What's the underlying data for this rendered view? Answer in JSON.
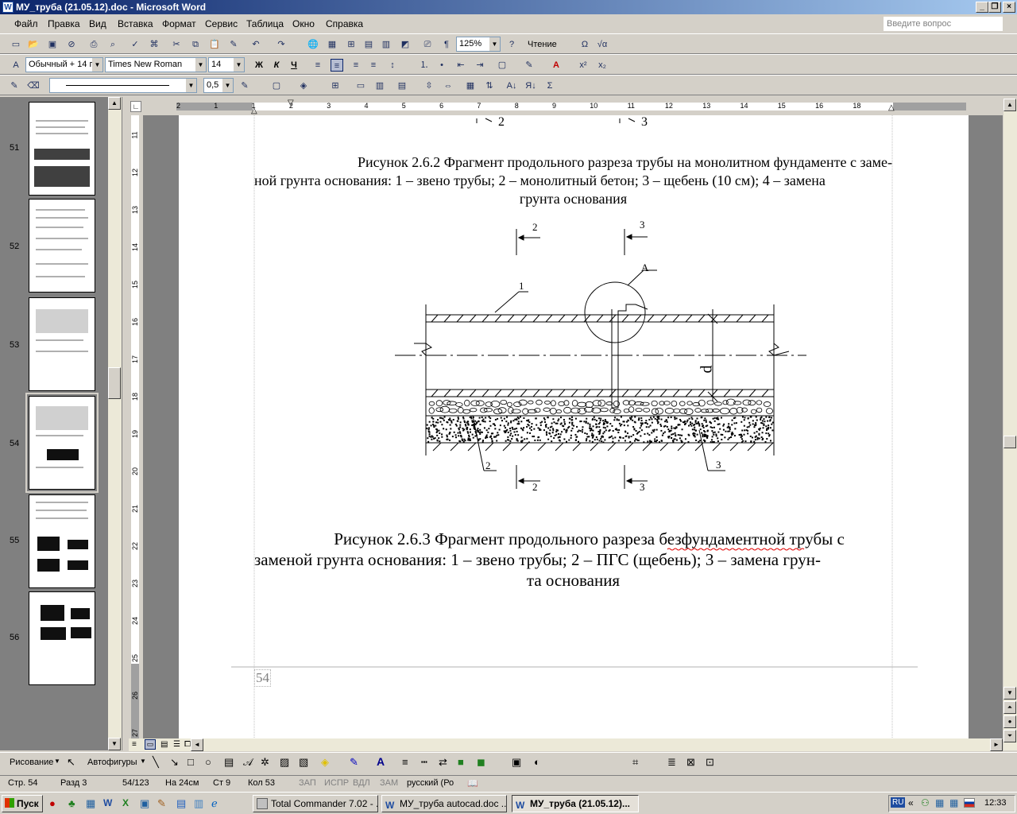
{
  "window": {
    "title": "МУ_труба (21.05.12).doc - Microsoft Word",
    "minimize": "_",
    "restore": "❐",
    "close": "×"
  },
  "menu": {
    "items": [
      "Файл",
      "Правка",
      "Вид",
      "Вставка",
      "Формат",
      "Сервис",
      "Таблица",
      "Окно",
      "Справка"
    ],
    "ask_placeholder": "Введите вопрос"
  },
  "toolbar1": {
    "zoom": "125%",
    "reading": "Чтение"
  },
  "toolbar2": {
    "style": "Обычный + 14 п",
    "font": "Times New Roman",
    "size": "14",
    "bold": "Ж",
    "italic": "К",
    "underline": "Ч"
  },
  "toolbar3": {
    "line_width": "0,5"
  },
  "ruler": {
    "h_ticks": [
      "2",
      "1",
      "1",
      "2",
      "3",
      "4",
      "5",
      "6",
      "7",
      "8",
      "9",
      "10",
      "11",
      "12",
      "13",
      "14",
      "15",
      "16",
      "18"
    ],
    "v_ticks": [
      "11",
      "12",
      "13",
      "14",
      "15",
      "16",
      "17",
      "18",
      "19",
      "20",
      "21",
      "22",
      "23",
      "24",
      "25",
      "26",
      "27"
    ]
  },
  "thumbnails": [
    {
      "num": "51"
    },
    {
      "num": "52"
    },
    {
      "num": "53"
    },
    {
      "num": "54"
    },
    {
      "num": "55"
    },
    {
      "num": "56"
    }
  ],
  "document": {
    "top_label_2": "2",
    "top_label_3": "3",
    "caption1": [
      "Рисунок 2.6.2 Фрагмент продольного разреза трубы на монолитном фундаменте с заме-",
      "ной грунта основания: 1 – звено трубы; 2 – монолитный бетон; 3 – щебень (10 см); 4 – замена",
      "грунта основания"
    ],
    "figure_labels": {
      "sec2_top": "2",
      "sec3_top": "3",
      "pos1": "1",
      "posA": "А",
      "dim": "d",
      "pos2": "2",
      "pos3": "3",
      "sec2_bot": "2",
      "sec3_bot": "3"
    },
    "caption2": [
      "Рисунок 2.6.3 Фрагмент продольного разреза безфундаментной трубы с",
      "заменой грунта основания: 1 – звено трубы; 2 – ПГС (щебень); 3 – замена грун-",
      "та основания"
    ],
    "page_number": "54"
  },
  "drawing": {
    "draw": "Рисование",
    "autoshapes": "Автофигуры"
  },
  "status": {
    "page": "Стр. 54",
    "section": "Разд 3",
    "pages": "54/123",
    "at": "На 24см",
    "line": "Ст 9",
    "col": "Кол 53",
    "rec": "ЗАП",
    "trk": "ИСПР",
    "ext": "ВДЛ",
    "ovr": "ЗАМ",
    "lang": "русский (Ро"
  },
  "taskbar": {
    "start": "Пуск",
    "tasks": [
      "Total Commander 7.02 - ...",
      "МУ_труба autocad.doc ...",
      "МУ_труба (21.05.12)..."
    ],
    "lang": "RU",
    "time": "12:33"
  }
}
